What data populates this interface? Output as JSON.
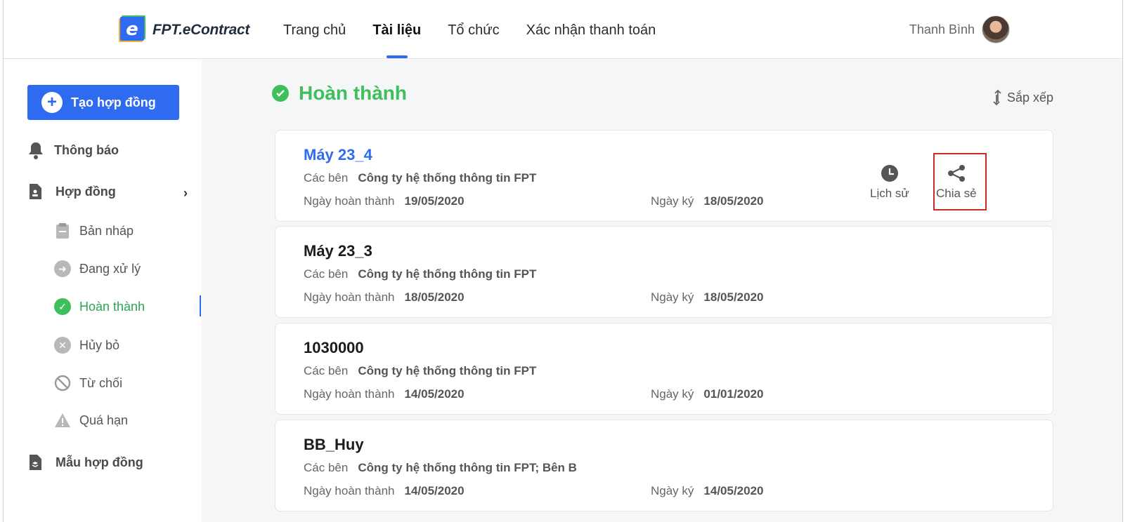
{
  "header": {
    "logo_text": "FPT.eContract",
    "nav": [
      "Trang chủ",
      "Tài liệu",
      "Tổ chức",
      "Xác nhận thanh toán"
    ],
    "active_nav": "Tài liệu",
    "user_name": "Thanh Bình"
  },
  "sidebar": {
    "create_button": "Tạo hợp đồng",
    "notifications": "Thông báo",
    "contracts": "Hợp đồng",
    "sub_items": [
      "Bản nháp",
      "Đang xử lý",
      "Hoàn thành",
      "Hủy bỏ",
      "Từ chối",
      "Quá hạn"
    ],
    "active_sub": "Hoàn thành",
    "templates": "Mẫu hợp đồng"
  },
  "main": {
    "title": "Hoàn thành",
    "sort_label": "Sắp xếp",
    "labels": {
      "parties": "Các bên",
      "completed_date": "Ngày hoàn thành",
      "signed_date": "Ngày ký"
    },
    "actions": {
      "history": "Lịch sử",
      "share": "Chia sẻ"
    },
    "cards": [
      {
        "title": "Máy 23_4",
        "parties": "Công ty hệ thống thông tin FPT",
        "completed": "19/05/2020",
        "signed": "18/05/2020"
      },
      {
        "title": "Máy 23_3",
        "parties": "Công ty hệ thống thông tin FPT",
        "completed": "18/05/2020",
        "signed": "18/05/2020"
      },
      {
        "title": "1030000",
        "parties": "Công ty hệ thống thông tin FPT",
        "completed": "14/05/2020",
        "signed": "01/01/2020"
      },
      {
        "title": "BB_Huy",
        "parties": "Công ty hệ thống thông tin FPT; Bên B",
        "completed": "14/05/2020",
        "signed": "14/05/2020"
      }
    ]
  },
  "colors": {
    "primary": "#2f6bf0",
    "success": "#3fbf5b",
    "highlight": "#c92a2a"
  }
}
